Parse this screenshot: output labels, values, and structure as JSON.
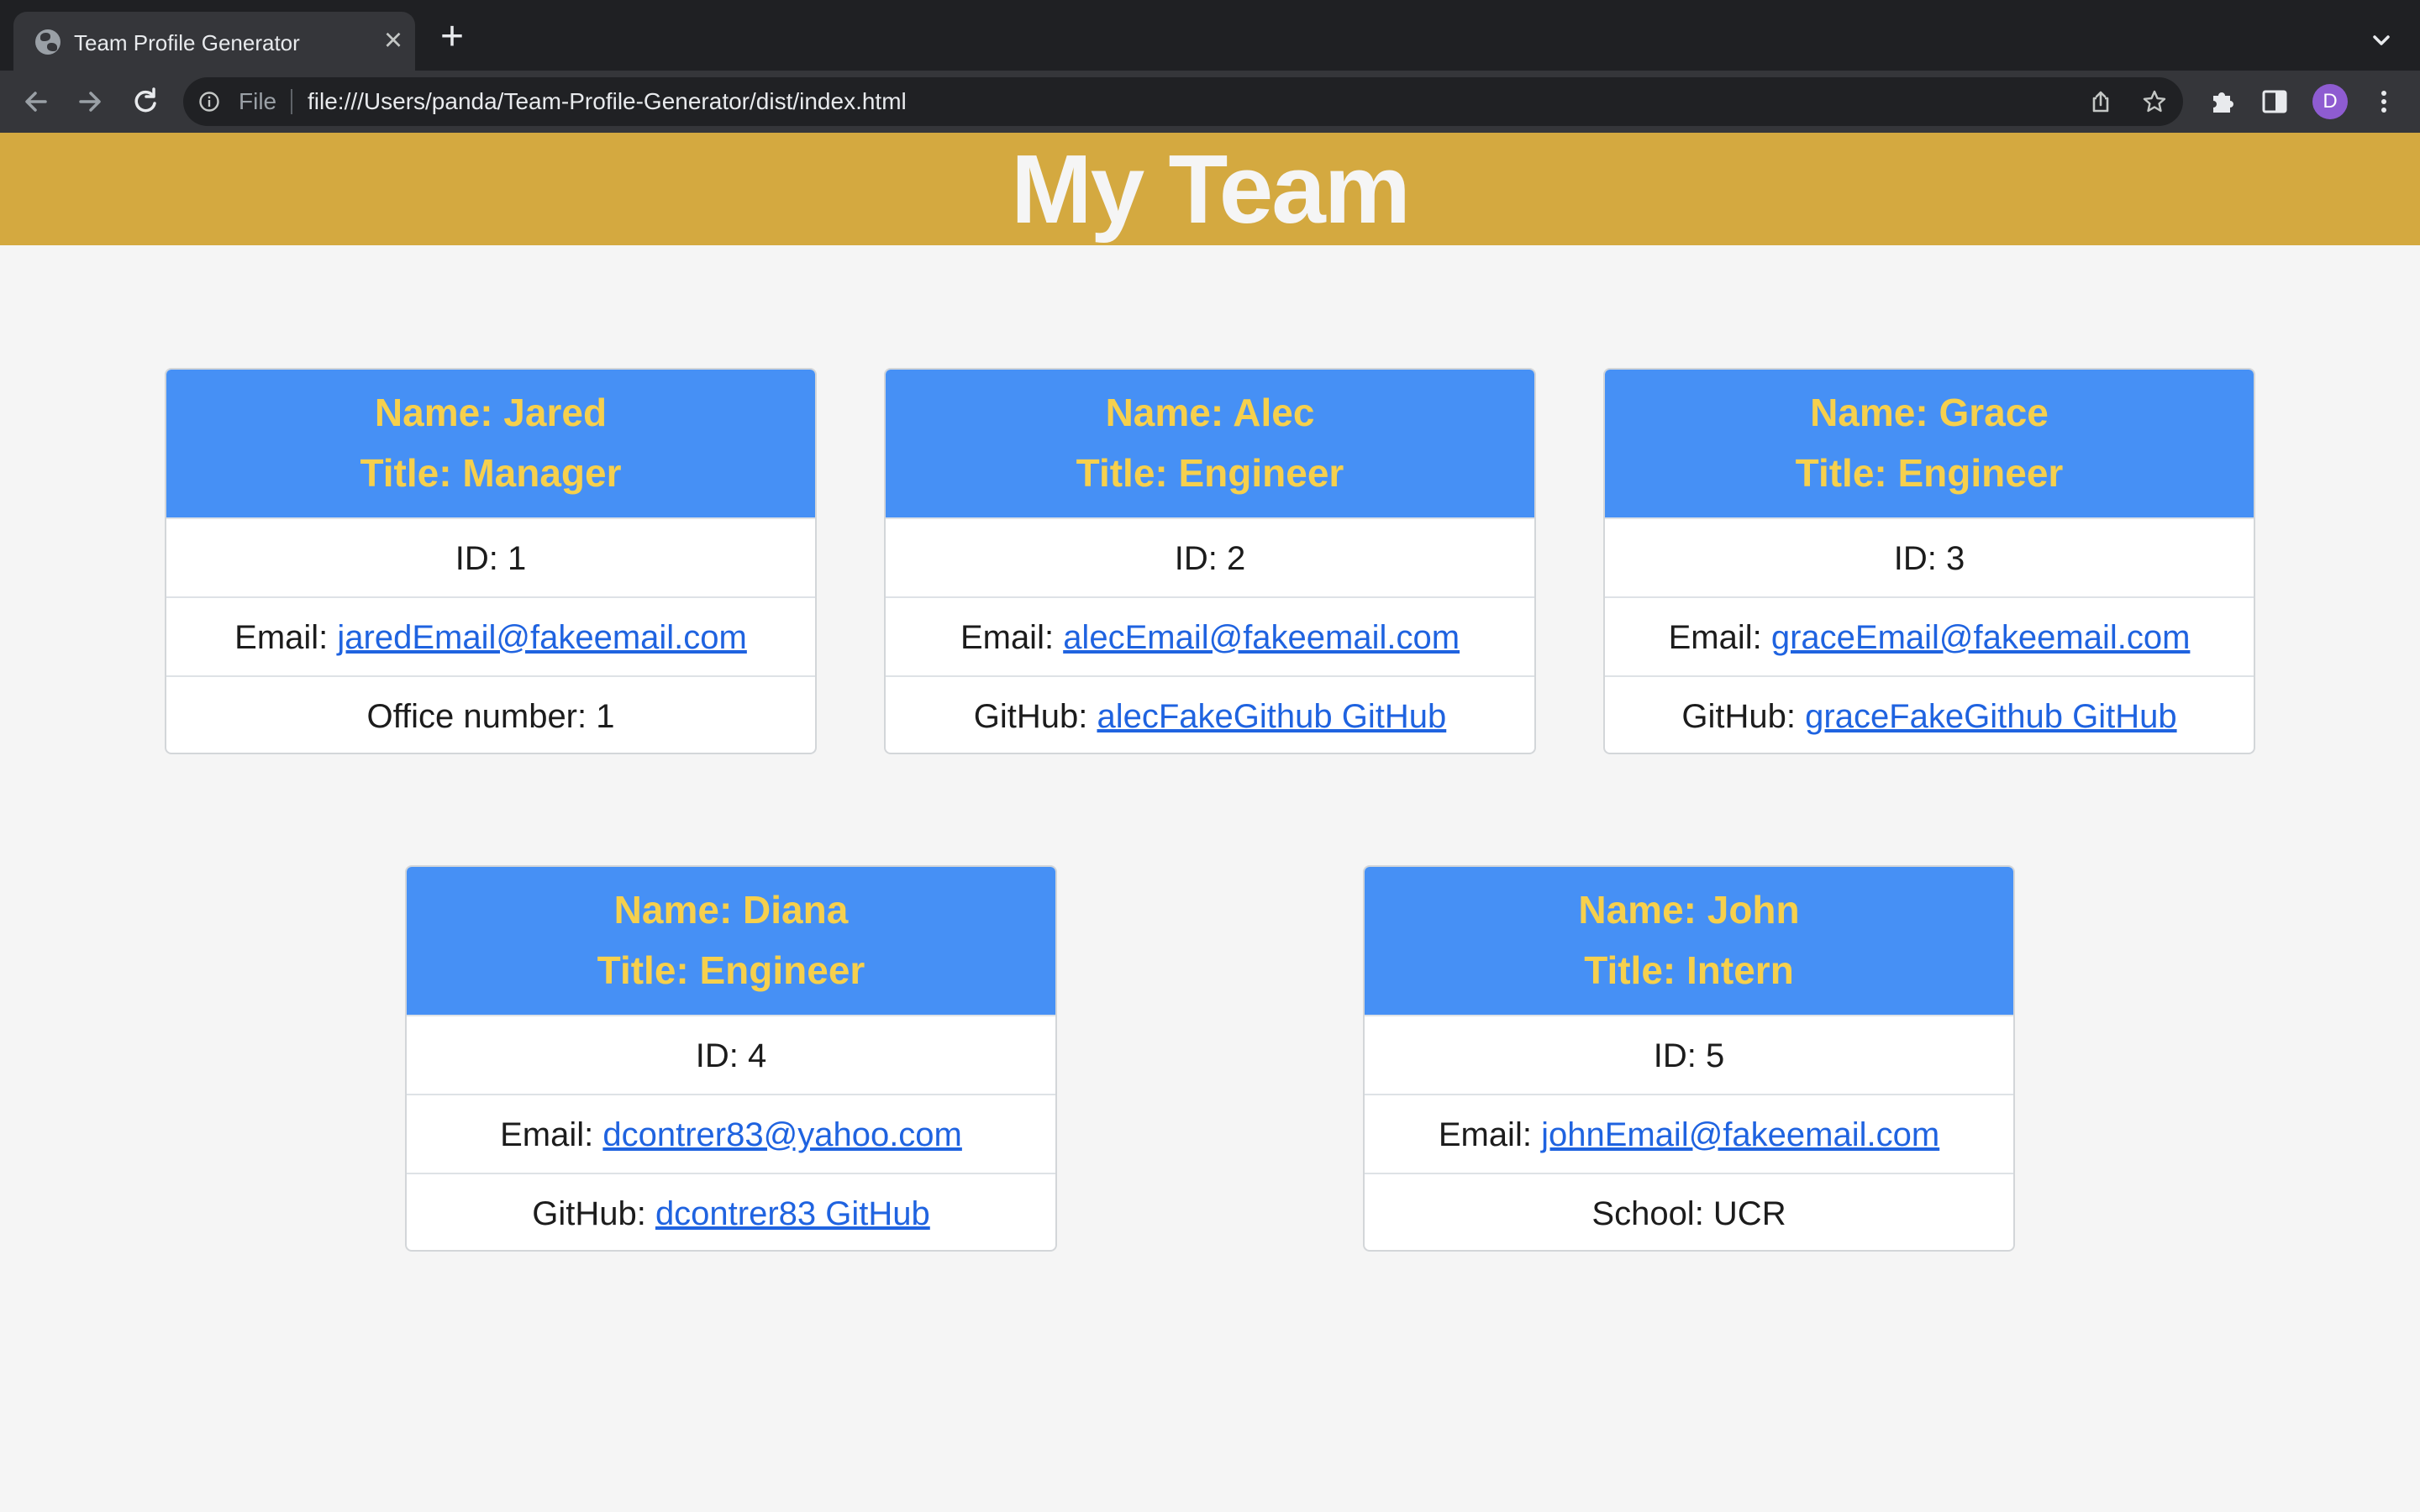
{
  "browser": {
    "tab_title": "Team Profile Generator",
    "close_glyph": "×",
    "new_tab_glyph": "+",
    "scheme_label": "File",
    "url": "file:///Users/panda/Team-Profile-Generator/dist/index.html",
    "profile_initial": "D"
  },
  "page": {
    "heading": "My Team"
  },
  "members": [
    {
      "name": "Name: Jared",
      "title": "Title: Manager",
      "id": "ID: 1",
      "email_label": "Email: ",
      "email": "jaredEmail@fakeemail.com",
      "extra_label": "Office number: 1",
      "extra_link": ""
    },
    {
      "name": "Name: Alec",
      "title": "Title: Engineer",
      "id": "ID: 2",
      "email_label": "Email: ",
      "email": "alecEmail@fakeemail.com",
      "extra_label": "GitHub: ",
      "extra_link": "alecFakeGithub GitHub"
    },
    {
      "name": "Name: Grace",
      "title": "Title: Engineer",
      "id": "ID: 3",
      "email_label": "Email: ",
      "email": "graceEmail@fakeemail.com",
      "extra_label": "GitHub: ",
      "extra_link": "graceFakeGithub GitHub"
    },
    {
      "name": "Name: Diana",
      "title": "Title: Engineer",
      "id": "ID: 4",
      "email_label": "Email: ",
      "email": "dcontrer83@yahoo.com",
      "extra_label": "GitHub: ",
      "extra_link": "dcontrer83 GitHub"
    },
    {
      "name": "Name: John",
      "title": "Title: Intern",
      "id": "ID: 5",
      "email_label": "Email: ",
      "email": "johnEmail@fakeemail.com",
      "extra_label": "School: UCR",
      "extra_link": ""
    }
  ],
  "icons": {
    "tab_favicon": "globe-icon",
    "back": "back-arrow-icon",
    "forward": "forward-arrow-icon",
    "reload": "reload-icon",
    "site_info": "info-icon",
    "share": "share-icon",
    "bookmark": "star-icon",
    "extensions": "puzzle-icon",
    "side_panel": "side-panel-icon",
    "menu": "kebab-menu-icon"
  },
  "colors": {
    "banner": "#d4a940",
    "card_header": "#4690f5",
    "card_header_text": "#f6d04d",
    "link": "#1f63e0",
    "page_background": "#f5f5f5"
  }
}
